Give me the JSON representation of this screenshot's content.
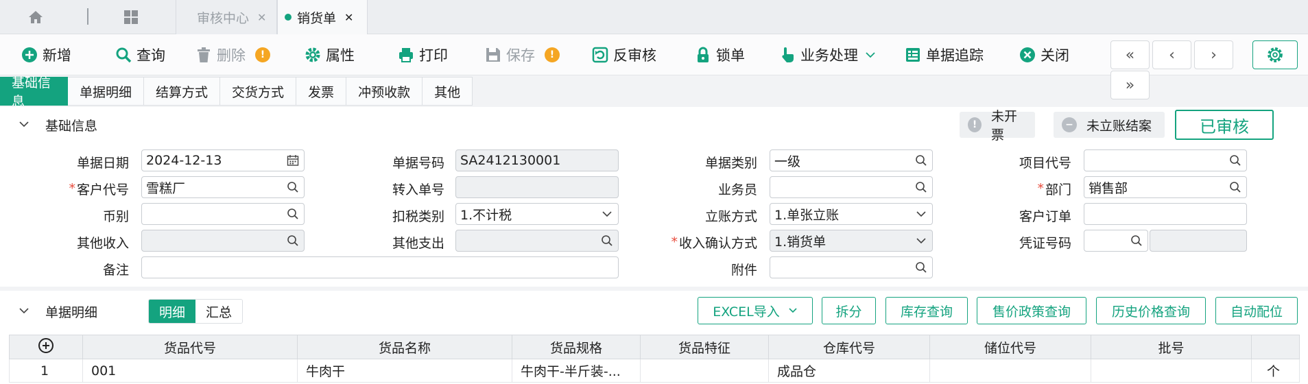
{
  "tabbar": {
    "icons": [
      "home-icon",
      "grid-icon"
    ],
    "tabs": [
      {
        "label": "审核中心",
        "close": "✕"
      },
      {
        "label": "销货单",
        "close": "✕"
      }
    ]
  },
  "toolbar": {
    "add": "新增",
    "query": "查询",
    "delete": "删除",
    "properties": "属性",
    "print": "打印",
    "save": "保存",
    "unaudit": "反审核",
    "lock": "锁单",
    "business": "业务处理",
    "trace": "单据追踪",
    "close": "关闭",
    "warn_mark": "!",
    "nav": [
      "«",
      "‹",
      "›",
      "»"
    ]
  },
  "section_tabs": [
    "基础信息",
    "单据明细",
    "结算方式",
    "交货方式",
    "发票",
    "冲预收款",
    "其他"
  ],
  "basic": {
    "title": "基础信息",
    "badge_invoice": "未开票",
    "badge_account": "未立账结案",
    "audited": "已审核",
    "fields": {
      "doc_date": {
        "label": "单据日期",
        "value": "2024-12-13"
      },
      "doc_no": {
        "label": "单据号码",
        "value": "SA2412130001"
      },
      "doc_type": {
        "label": "单据类别",
        "value": "一级"
      },
      "project": {
        "label": "项目代号",
        "value": ""
      },
      "customer": {
        "label": "客户代号",
        "value": "雪糕厂"
      },
      "transfer": {
        "label": "转入单号",
        "value": ""
      },
      "salesman": {
        "label": "业务员",
        "value": ""
      },
      "dept": {
        "label": "部门",
        "value": "销售部"
      },
      "currency": {
        "label": "币别",
        "value": ""
      },
      "tax_type": {
        "label": "扣税类别",
        "value": "1.不计税"
      },
      "account_mode": {
        "label": "立账方式",
        "value": "1.单张立账"
      },
      "cust_order": {
        "label": "客户订单",
        "value": ""
      },
      "other_income": {
        "label": "其他收入",
        "value": ""
      },
      "other_expense": {
        "label": "其他支出",
        "value": ""
      },
      "revenue_mode": {
        "label": "收入确认方式",
        "value": "1.销货单"
      },
      "voucher": {
        "label": "凭证号码",
        "value": ""
      },
      "remark": {
        "label": "备注",
        "value": ""
      },
      "attachment": {
        "label": "附件",
        "value": ""
      }
    }
  },
  "detail": {
    "title": "单据明细",
    "seg": [
      "明细",
      "汇总"
    ],
    "buttons": [
      "EXCEL导入",
      "拆分",
      "库存查询",
      "售价政策查询",
      "历史价格查询",
      "自动配位"
    ],
    "columns": [
      "货品代号",
      "货品名称",
      "货品规格",
      "货品特征",
      "仓库代号",
      "储位代号",
      "批号"
    ],
    "rows": [
      {
        "no": "1",
        "code": "001",
        "name": "牛肉干",
        "spec": "牛肉干-半斤装-...",
        "feature": "",
        "warehouse": "成品仓",
        "location": "",
        "batch": "",
        "unit": "个"
      }
    ]
  }
}
